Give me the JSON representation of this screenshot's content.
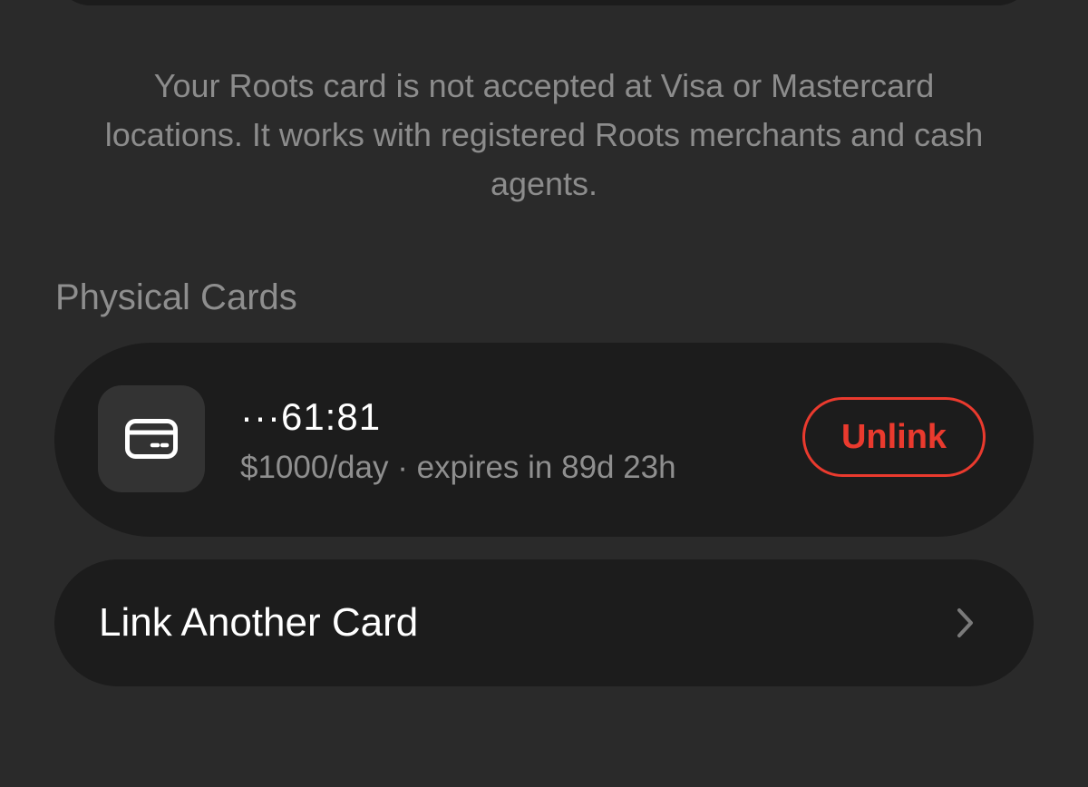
{
  "notice": {
    "text": "Your Roots card is not accepted at Visa or Mastercard locations. It works with registered Roots merchants and cash agents."
  },
  "physical_cards": {
    "section_title": "Physical Cards",
    "cards": [
      {
        "icon": "credit-card-icon",
        "masked_number": "···61:81",
        "details": "$1000/day · expires in 89d 23h",
        "action_label": "Unlink"
      }
    ]
  },
  "link_another": {
    "label": "Link Another Card",
    "icon": "chevron-right-icon"
  },
  "colors": {
    "background": "#2a2a2a",
    "surface": "#1c1c1c",
    "icon_tile": "#333333",
    "primary_text": "#ffffff",
    "secondary_text": "#8e8e8e",
    "destructive": "#ea3a2e"
  }
}
